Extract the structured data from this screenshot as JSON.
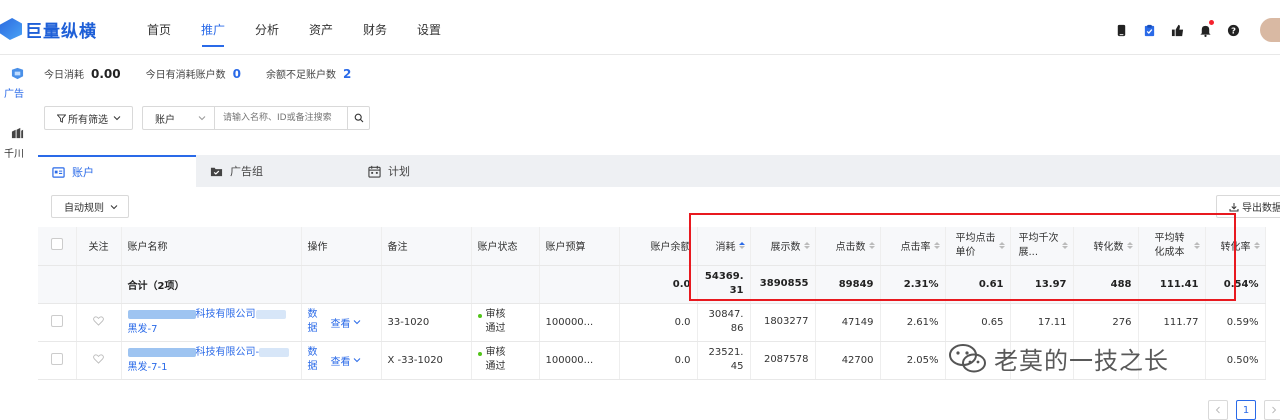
{
  "app": {
    "logo_text": "巨量纵横",
    "nav": [
      {
        "label": "首页",
        "active": false
      },
      {
        "label": "推广",
        "active": true
      },
      {
        "label": "分析",
        "active": false
      },
      {
        "label": "资产",
        "active": false
      },
      {
        "label": "财务",
        "active": false
      },
      {
        "label": "设置",
        "active": false
      }
    ],
    "top_icons": [
      "phone-icon",
      "clipboard-icon",
      "thumbs-up-icon",
      "bell-icon",
      "help-icon"
    ]
  },
  "sidebar": {
    "items": [
      {
        "label": "广告",
        "icon": "ad-icon",
        "active": true
      },
      {
        "label": "千川",
        "icon": "qianchuan-icon",
        "active": false
      }
    ]
  },
  "stats": {
    "today_spend_label": "今日消耗",
    "today_spend_value": "0.00",
    "spending_accounts_label": "今日有消耗账户数",
    "spending_accounts_value": "0",
    "low_balance_label": "余额不足账户数",
    "low_balance_value": "2"
  },
  "filters": {
    "all_filters_label": "所有筛选",
    "search_scope": "账户",
    "search_placeholder": "请输入名称、ID或备注搜索"
  },
  "tabs": [
    {
      "label": "账户",
      "icon": "account-icon",
      "active": true
    },
    {
      "label": "广告组",
      "icon": "folder-check-icon",
      "active": false
    },
    {
      "label": "计划",
      "icon": "calendar-icon",
      "active": false
    }
  ],
  "toolbar": {
    "auto_rule_label": "自动规则",
    "export_label": "导出数据"
  },
  "table": {
    "headers": {
      "follow": "关注",
      "name": "账户名称",
      "ops": "操作",
      "note": "备注",
      "status": "账户状态",
      "budget": "账户预算",
      "balance": "账户余额",
      "cost": "消耗",
      "impressions": "展示数",
      "clicks": "点击数",
      "ctr": "点击率",
      "cpc": "平均点击单价",
      "cpm": "平均千次展...",
      "conversions": "转化数",
      "cpa": "平均转化成本",
      "cvr": "转化率"
    },
    "total": {
      "label": "合计（2项）",
      "balance": "0.0",
      "cost": "54369.31",
      "impressions": "3890855",
      "clicks": "89849",
      "ctr": "2.31%",
      "cpc": "0.61",
      "cpm": "13.97",
      "conversions": "488",
      "cpa": "111.41",
      "cvr": "0.54%"
    },
    "rows": [
      {
        "name_mid": "科技有限公司",
        "name_line2": "黑发-7",
        "op_data": "数据",
        "op_view": "查看",
        "note": "33-1020",
        "status": "审核通过",
        "budget": "100000...",
        "balance": "0.0",
        "cost": "30847.86",
        "impressions": "1803277",
        "clicks": "47149",
        "ctr": "2.61%",
        "cpc": "0.65",
        "cpm": "17.11",
        "conversions": "276",
        "cpa": "111.77",
        "cvr": "0.59%"
      },
      {
        "name_mid": "科技有限公司-",
        "name_line2": "黑发-7-1",
        "op_data": "数据",
        "op_view": "查看",
        "note": "X -33-1020",
        "status": "审核通过",
        "budget": "100000...",
        "balance": "0.0",
        "cost": "23521.45",
        "impressions": "2087578",
        "clicks": "42700",
        "ctr": "2.05%",
        "cpc": "",
        "cpm": "",
        "conversions": "",
        "cpa": "",
        "cvr": "0.50%"
      }
    ]
  },
  "watermark": {
    "text": "老莫的一技之长",
    "icon": "wechat-icon"
  },
  "pager": {
    "current": "1"
  },
  "colors": {
    "accent": "#2a6ae8",
    "highlight_box": "#e8191f",
    "status_ok": "#52c41a"
  }
}
